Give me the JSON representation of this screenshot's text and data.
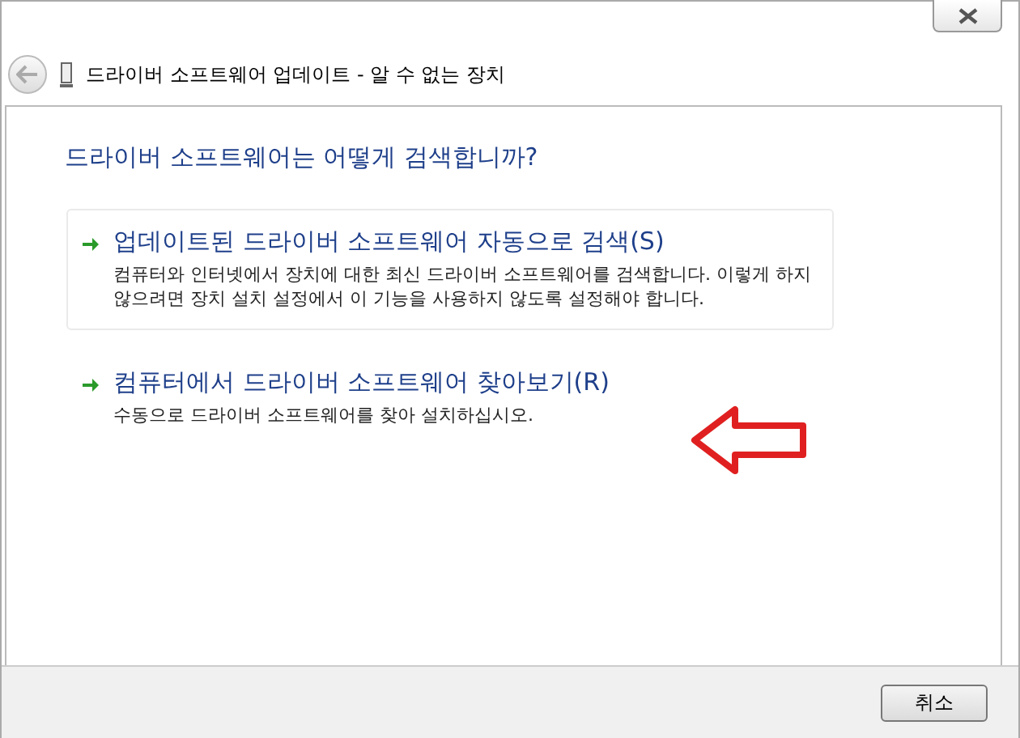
{
  "window": {
    "title": "드라이버 소프트웨어 업데이트 - 알 수 없는 장치"
  },
  "heading": "드라이버 소프트웨어는 어떻게 검색합니까?",
  "options": [
    {
      "title": "업데이트된 드라이버 소프트웨어 자동으로 검색(S)",
      "description": "컴퓨터와 인터넷에서 장치에 대한 최신 드라이버 소프트웨어를 검색합니다. 이렇게 하지 않으려면 장치 설치 설정에서 이 기능을 사용하지 않도록 설정해야 합니다.",
      "selected": true
    },
    {
      "title": "컴퓨터에서 드라이버 소프트웨어 찾아보기(R)",
      "description": "수동으로 드라이버 소프트웨어를 찾아 설치하십시오.",
      "selected": false
    }
  ],
  "buttons": [
    "취소"
  ]
}
